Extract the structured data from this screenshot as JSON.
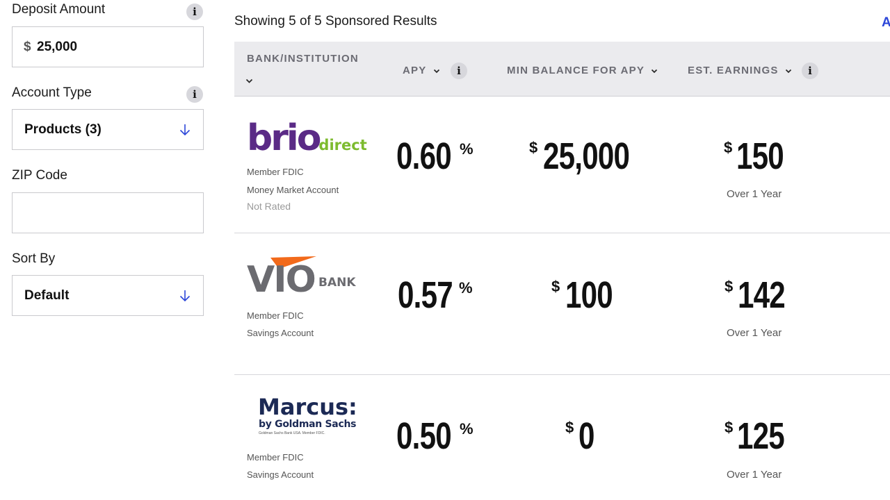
{
  "sidebar": {
    "deposit": {
      "label": "Deposit Amount",
      "currency": "$",
      "value": "25,000",
      "info": "i"
    },
    "account_type": {
      "label": "Account Type",
      "value": "Products (3)",
      "info": "i"
    },
    "zip": {
      "label": "ZIP Code",
      "value": ""
    },
    "sort": {
      "label": "Sort By",
      "value": "Default"
    }
  },
  "main": {
    "results_count": "Showing 5 of 5 Sponsored Results",
    "clipped_link": "A",
    "columns": {
      "bank": "BANK/INSTITUTION",
      "apy": "APY",
      "min_balance": "MIN BALANCE FOR APY",
      "earnings": "EST. EARNINGS",
      "info": "i"
    },
    "rows": [
      {
        "logo": {
          "name": "brio",
          "suffix": "direct"
        },
        "member": "Member FDIC",
        "product": "Money Market Account",
        "rating": "Not Rated",
        "apy": "0.60",
        "min_balance": "25,000",
        "earnings": "150",
        "period": "Over 1 Year"
      },
      {
        "logo": {
          "name": "VIO",
          "suffix": "BANK"
        },
        "member": "Member FDIC",
        "product": "Savings Account",
        "apy": "0.57",
        "min_balance": "100",
        "earnings": "142",
        "period": "Over 1 Year"
      },
      {
        "logo": {
          "name": "Marcus:",
          "suffix": "by Goldman Sachs",
          "fine_print": "Goldman Sachs Bank USA. Member FDIC."
        },
        "member": "Member FDIC",
        "product": "Savings Account",
        "apy": "0.50",
        "min_balance": "0",
        "earnings": "125",
        "period": "Over 1 Year"
      }
    ],
    "symbols": {
      "percent": "%",
      "dollar": "$"
    }
  },
  "colors": {
    "accent_blue": "#2c46d8",
    "brio_purple": "#5a2a86",
    "brio_green": "#7dbb2f",
    "vio_gray": "#6b6b70",
    "vio_orange": "#f26a1b",
    "marcus_navy": "#1c2a55",
    "header_bg": "#ebebee"
  }
}
